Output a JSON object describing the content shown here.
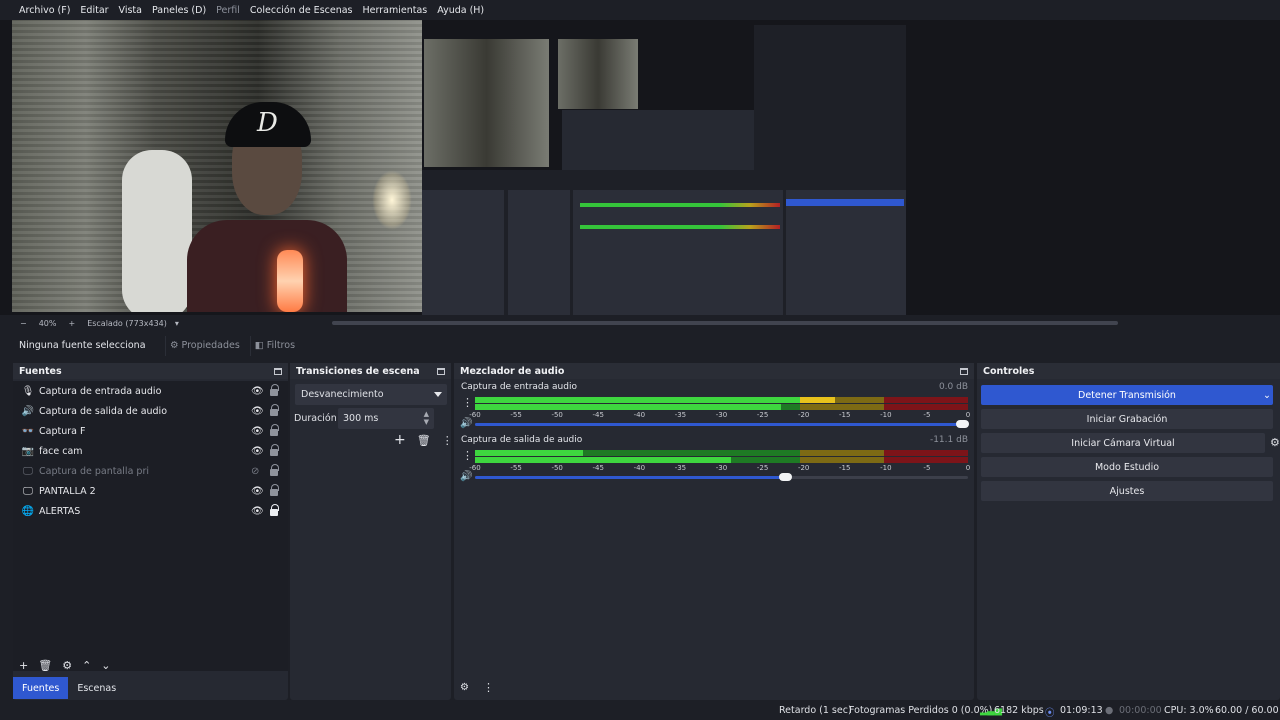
{
  "menu": [
    "Archivo (F)",
    "Editar",
    "Vista",
    "Paneles (D)",
    "Perfil",
    "Colección de Escenas",
    "Herramientas",
    "Ayuda (H)"
  ],
  "zoom": {
    "minus": "−",
    "value": "40%",
    "plus": "+",
    "scale_label": "Escalado (773x434)"
  },
  "context": {
    "no_source": "Ninguna fuente selecciona",
    "properties": "Propiedades",
    "filters": "Filtros"
  },
  "sources": {
    "title": "Fuentes",
    "items": [
      {
        "label": "Captura de entrada audio",
        "icon": "mic-icon",
        "glyph": "🎙",
        "visible": true,
        "locked": false
      },
      {
        "label": "Captura de salida de audio",
        "icon": "speaker-icon",
        "glyph": "🔊",
        "visible": true,
        "locked": false
      },
      {
        "label": "Captura F",
        "icon": "glasses-icon",
        "glyph": "👓",
        "visible": true,
        "locked": false
      },
      {
        "label": "face cam",
        "icon": "camera-icon",
        "glyph": "📷",
        "visible": true,
        "locked": false
      },
      {
        "label": "Captura de pantalla pri",
        "icon": "monitor-icon",
        "glyph": "🖵",
        "visible": false,
        "locked": false
      },
      {
        "label": "PANTALLA 2",
        "icon": "monitor-icon",
        "glyph": "🖵",
        "visible": true,
        "locked": false
      },
      {
        "label": "ALERTAS",
        "icon": "globe-icon",
        "glyph": "🌐",
        "visible": true,
        "locked": true
      }
    ],
    "tabs": [
      "Fuentes",
      "Escenas"
    ]
  },
  "transitions": {
    "title": "Transiciones de escena",
    "selected": "Desvanecimiento",
    "duration_label": "Duración",
    "duration_value": "300 ms"
  },
  "mixer": {
    "title": "Mezclador de audio",
    "ticks": [
      "-60",
      "-55",
      "-50",
      "-45",
      "-40",
      "-35",
      "-30",
      "-25",
      "-20",
      "-15",
      "-10",
      "-5",
      "0"
    ],
    "channels": [
      {
        "name": "Captura de entrada audio",
        "db": "0.0 dB",
        "level_top": 0.73,
        "level_bottom": 0.62,
        "volume": 0.99
      },
      {
        "name": "Captura de salida de audio",
        "db": "-11.1 dB",
        "level_top": 0.22,
        "level_bottom": 0.52,
        "volume": 0.63
      }
    ]
  },
  "controls": {
    "title": "Controles",
    "buttons": [
      "Detener Transmisión",
      "Iniciar Grabación",
      "Iniciar Cámara Virtual",
      "Modo Estudio",
      "Ajustes"
    ]
  },
  "status": {
    "delay": "Retardo (1 sec)",
    "dropped": "Fotogramas Perdidos 0 (0.0%)",
    "bitrate": "6182 kbps",
    "stream_time": "01:09:13",
    "rec_time": "00:00:00",
    "cpu": "CPU: 3.0%",
    "fps": "60.00 / 60.00 FP"
  },
  "colors": {
    "accent": "#2f58d0",
    "panel": "#262932",
    "background": "#1d1f26"
  }
}
